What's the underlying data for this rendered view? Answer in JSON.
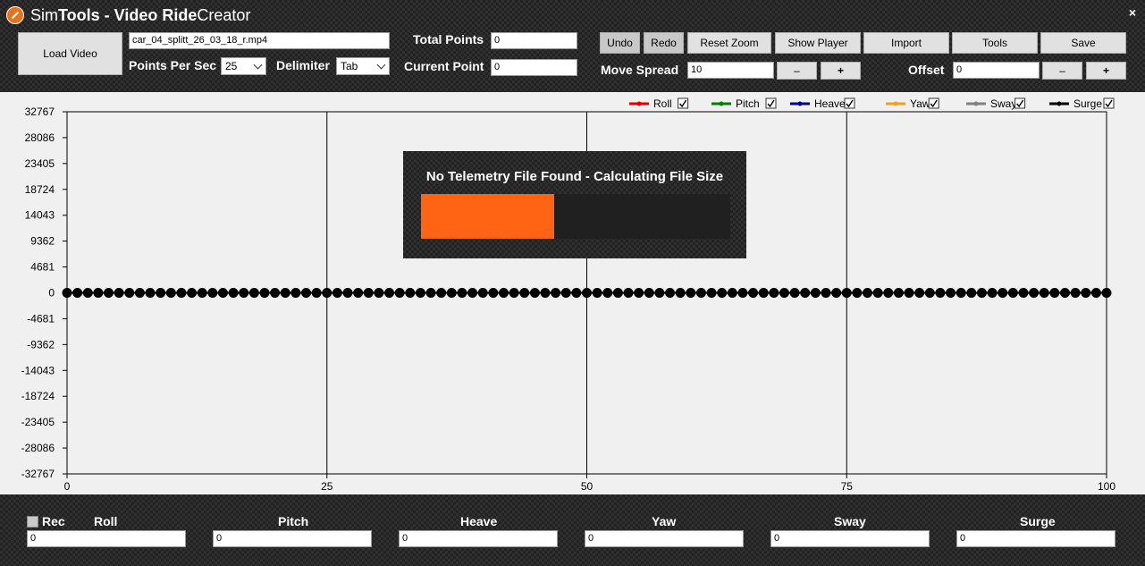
{
  "window": {
    "title_sim": "Sim",
    "title_tools": "Tools - ",
    "title_vr": "Video Ride",
    "title_creator": " Creator",
    "close": "×"
  },
  "toolbar": {
    "load_video": "Load Video",
    "video_file": "car_04_splitt_26_03_18_r.mp4",
    "points_per_sec_label": "Points Per Sec",
    "points_per_sec_value": "25",
    "delimiter_label": "Delimiter",
    "delimiter_value": "Tab",
    "total_points_label": "Total Points",
    "total_points_value": "0",
    "current_point_label": "Current Point",
    "current_point_value": "0",
    "undo": "Undo",
    "redo": "Redo",
    "reset_zoom": "Reset Zoom",
    "show_player": "Show Player",
    "import": "Import",
    "tools": "Tools",
    "save": "Save",
    "move_spread_label": "Move Spread",
    "move_spread_value": "10",
    "offset_label": "Offset",
    "offset_value": "0",
    "minus": "–",
    "plus": "+"
  },
  "chart_data": {
    "type": "line",
    "x": [
      0,
      1,
      2,
      3,
      4,
      5,
      6,
      7,
      8,
      9,
      10,
      11,
      12,
      13,
      14,
      15,
      16,
      17,
      18,
      19,
      20,
      21,
      22,
      23,
      24,
      25,
      26,
      27,
      28,
      29,
      30,
      31,
      32,
      33,
      34,
      35,
      36,
      37,
      38,
      39,
      40,
      41,
      42,
      43,
      44,
      45,
      46,
      47,
      48,
      49,
      50,
      51,
      52,
      53,
      54,
      55,
      56,
      57,
      58,
      59,
      60,
      61,
      62,
      63,
      64,
      65,
      66,
      67,
      68,
      69,
      70,
      71,
      72,
      73,
      74,
      75,
      76,
      77,
      78,
      79,
      80,
      81,
      82,
      83,
      84,
      85,
      86,
      87,
      88,
      89,
      90,
      91,
      92,
      93,
      94,
      95,
      96,
      97,
      98,
      99,
      100
    ],
    "series": [
      {
        "name": "Roll",
        "color": "#e00000",
        "value": 0
      },
      {
        "name": "Pitch",
        "color": "#008000",
        "value": 0
      },
      {
        "name": "Heave",
        "color": "#00008b",
        "value": 0
      },
      {
        "name": "Yaw",
        "color": "#f0a020",
        "value": 0
      },
      {
        "name": "Sway",
        "color": "#808080",
        "value": 0
      },
      {
        "name": "Surge",
        "color": "#000000",
        "value": 0
      }
    ],
    "yticks": [
      32767,
      28086,
      23405,
      18724,
      14043,
      9362,
      4681,
      0,
      -4681,
      -9362,
      -14043,
      -18724,
      -23405,
      -28086,
      -32767
    ],
    "xticks": [
      0,
      25,
      50,
      75,
      100
    ],
    "ylim": [
      -32767,
      32767
    ],
    "xlim": [
      0,
      100
    ],
    "grid": "vertical",
    "legend": "top-right"
  },
  "progress": {
    "text": "No Telemetry File Found - Calculating File Size",
    "fraction": 0.43
  },
  "bottom": {
    "rec": "Rec",
    "fields": [
      {
        "label": "Roll",
        "value": "0"
      },
      {
        "label": "Pitch",
        "value": "0"
      },
      {
        "label": "Heave",
        "value": "0"
      },
      {
        "label": "Yaw",
        "value": "0"
      },
      {
        "label": "Sway",
        "value": "0"
      },
      {
        "label": "Surge",
        "value": "0"
      }
    ]
  }
}
